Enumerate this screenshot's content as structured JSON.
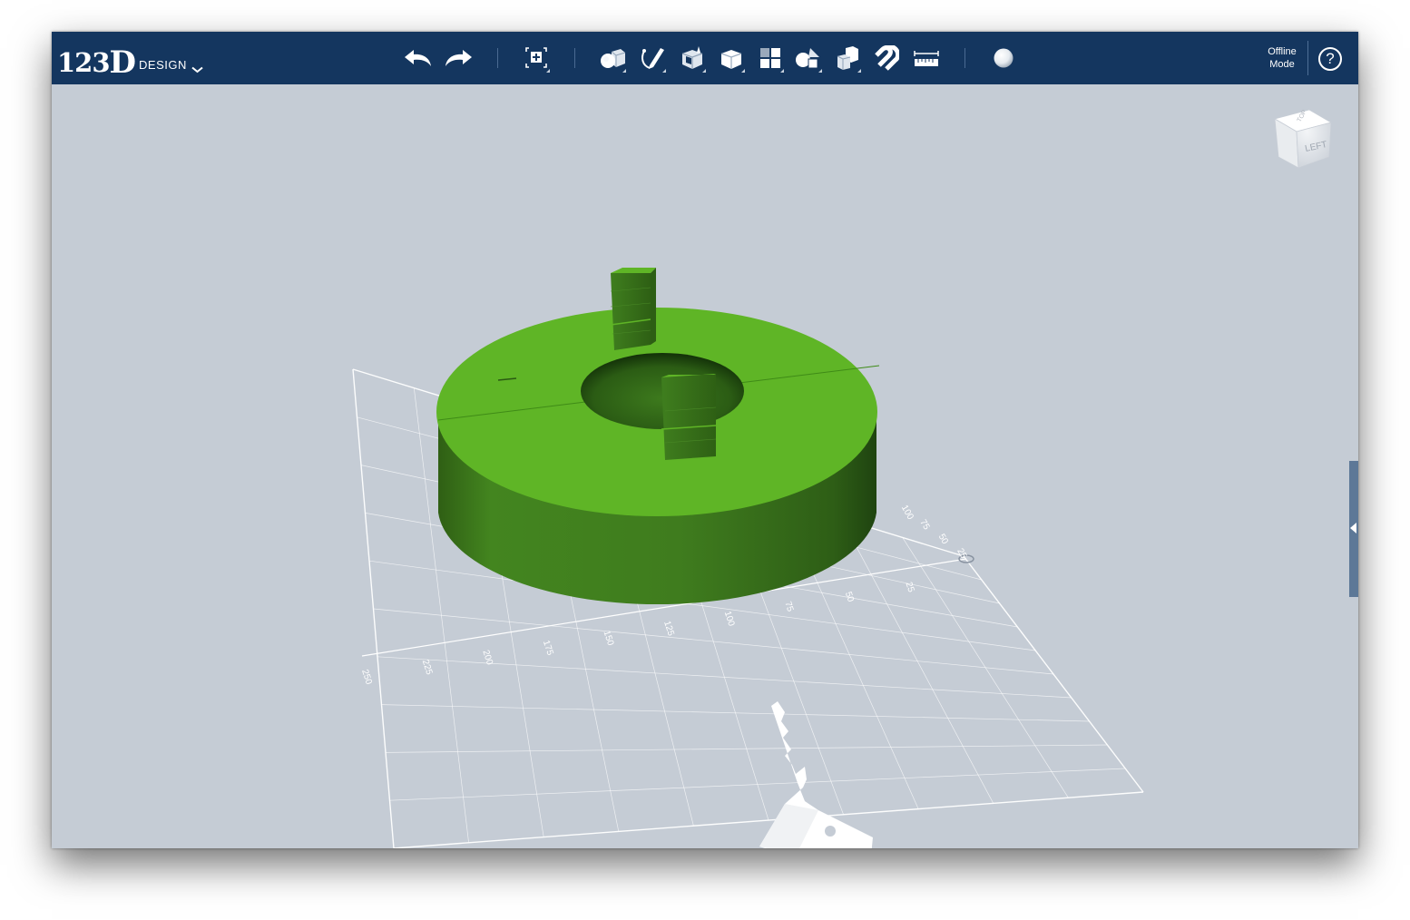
{
  "app": {
    "brand_number": "123",
    "brand_letter": "D",
    "brand_word": "DESIGN",
    "status_line1": "Offline",
    "status_line2": "Mode",
    "help_glyph": "?"
  },
  "toolbar": {
    "buttons": [
      {
        "name": "undo-button",
        "icon": "undo-arrow-icon"
      },
      {
        "name": "redo-button",
        "icon": "redo-arrow-icon"
      },
      {
        "name": "transform-button",
        "icon": "transform-icon"
      },
      {
        "name": "primitives-button",
        "icon": "primitives-icon"
      },
      {
        "name": "sketch-button",
        "icon": "sketch-icon"
      },
      {
        "name": "construct-button",
        "icon": "construct-icon"
      },
      {
        "name": "modify-button",
        "icon": "modify-icon"
      },
      {
        "name": "pattern-button",
        "icon": "pattern-icon"
      },
      {
        "name": "grouping-button",
        "icon": "grouping-icon"
      },
      {
        "name": "combine-button",
        "icon": "combine-icon"
      },
      {
        "name": "snap-button",
        "icon": "magnet-icon"
      },
      {
        "name": "measure-button",
        "icon": "ruler-icon"
      },
      {
        "name": "material-button",
        "icon": "material-sphere-icon"
      }
    ]
  },
  "viewcube": {
    "face_left": "LEFT",
    "face_top": "TOP"
  },
  "grid": {
    "x_labels": [
      "250",
      "225",
      "200",
      "175",
      "150",
      "125",
      "100",
      "75",
      "50",
      "25"
    ],
    "z_labels": [
      "100",
      "75",
      "50",
      "25"
    ]
  },
  "colors": {
    "toolbar_bg": "#14365f",
    "viewport_bg": "#c5ccd5",
    "model_green_top": "#5fb526",
    "model_green_side": "#3d7a1d"
  }
}
